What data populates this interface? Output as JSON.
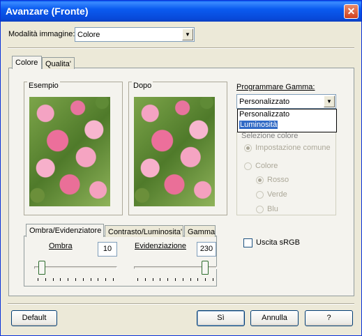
{
  "window": {
    "title": "Avanzare (Fronte)",
    "close_glyph": "✕"
  },
  "image_mode": {
    "label": "Modalità immagine:",
    "value": "Colore"
  },
  "tabs": [
    "Colore",
    "Qualita'"
  ],
  "preview": {
    "before_label": "Esempio",
    "after_label": "Dopo"
  },
  "gamma": {
    "label": "Programmare Gamma:",
    "value": "Personalizzato",
    "options": [
      "Personalizzato",
      "Luminosità"
    ],
    "selected_option": "Luminosità"
  },
  "color_selection": {
    "title": "Selezione colore",
    "common_setting": "Impostazione comune",
    "color": "Colore",
    "red": "Rosso",
    "green": "Verde",
    "blue": "Blu"
  },
  "subtabs": [
    "Ombra/Evidenziatore",
    "Contrasto/Luminosita'",
    "Gamma"
  ],
  "shadow": {
    "label": "Ombra",
    "value": "10",
    "level": 0.04
  },
  "highlight": {
    "label": "Evidenziazione",
    "value": "230",
    "level": 0.9
  },
  "srgb": {
    "label": "Uscita sRGB",
    "checked": false
  },
  "buttons": {
    "default": "Default",
    "ok": "Sì",
    "cancel": "Annulla",
    "help": "?"
  },
  "colors": {
    "titlebar": "#0a5bf0",
    "selection": "#316ac5",
    "face": "#ece9d8"
  }
}
